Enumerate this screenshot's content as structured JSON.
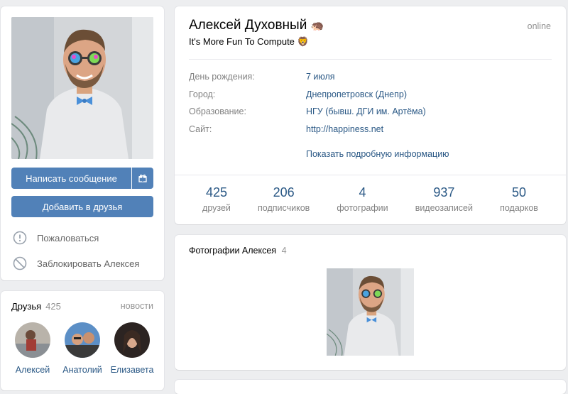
{
  "profile": {
    "name": "Алексей Духовный",
    "name_emoji": "🦔",
    "status": "It's More Fun To Compute",
    "status_emoji": "🦁",
    "online": "online"
  },
  "left": {
    "message_button": "Написать сообщение",
    "add_friend_button": "Добавить в друзья",
    "report": "Пожаловаться",
    "block": "Заблокировать Алексея"
  },
  "info": {
    "rows": [
      {
        "label": "День рождения:",
        "value": "7 июля"
      },
      {
        "label": "Город:",
        "value": "Днепропетровск (Днепр)"
      },
      {
        "label": "Образование:",
        "value": "НГУ (бывш. ДГИ им. Артёма)"
      },
      {
        "label": "Сайт:",
        "value": "http://happiness.net"
      }
    ],
    "more_link": "Показать подробную информацию"
  },
  "stats": [
    {
      "num": "425",
      "label": "друзей"
    },
    {
      "num": "206",
      "label": "подписчиков"
    },
    {
      "num": "4",
      "label": "фотографии"
    },
    {
      "num": "937",
      "label": "видеозаписей"
    },
    {
      "num": "50",
      "label": "подарков"
    }
  ],
  "friends": {
    "title": "Друзья",
    "count": "425",
    "news": "новости",
    "items": [
      {
        "name": "Алексей"
      },
      {
        "name": "Анатолий"
      },
      {
        "name": "Елизавета"
      }
    ]
  },
  "photos": {
    "title": "Фотографии Алексея",
    "count": "4"
  },
  "colors": {
    "accent": "#5181b8",
    "link": "#2a5885",
    "background": "#edeef0"
  }
}
